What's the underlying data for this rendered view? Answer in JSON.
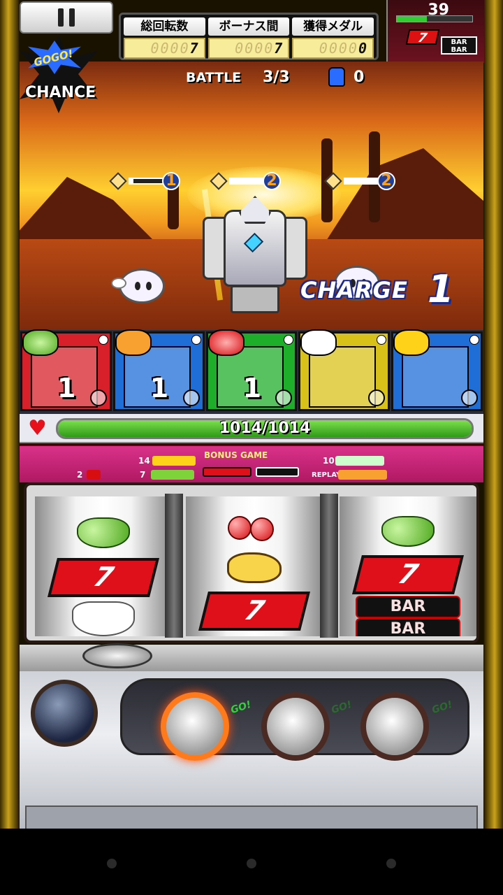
{
  "hud": {
    "counters": [
      {
        "label": "総回転数",
        "dim_digits": "0000",
        "value": "7"
      },
      {
        "label": "ボーナス間",
        "dim_digits": "0000",
        "value": "7"
      },
      {
        "label": "獲得メダル",
        "dim_digits": "0000",
        "value": "0"
      }
    ],
    "credit": "39",
    "credit_bar_level": 0.4,
    "credit_seven": "7",
    "credit_bar": "BAR BAR"
  },
  "badge": {
    "gogo": "GOGO!",
    "chance": "CHANCE"
  },
  "battle": {
    "label": "BATTLE",
    "round": "3/3",
    "bag_count": "0",
    "enemy_turns": [
      "1",
      "2",
      "2"
    ],
    "enemy_hp_levels": [
      0.1,
      1.0,
      1.0
    ],
    "charge_label": "CHARGE",
    "charge_value": "1"
  },
  "cards": [
    {
      "color": "#d8202a",
      "emblem": "grapes-icon",
      "count": "1"
    },
    {
      "color": "#1f6ed8",
      "emblem": "rhino-icon",
      "count": "1"
    },
    {
      "color": "#1fae2a",
      "emblem": "cherry-icon",
      "count": "1"
    },
    {
      "color": "#d8c21a",
      "emblem": "clown-icon",
      "count": ""
    },
    {
      "color": "#1f6ed8",
      "emblem": "bell-icon",
      "count": ""
    }
  ],
  "hp": {
    "text": "1014/1014",
    "level": 1.0
  },
  "paytable": {
    "title": "BONUS GAME",
    "n14": "14",
    "n10": "10",
    "n2": "2",
    "n7": "7",
    "replay": "REPLAY"
  },
  "reels": {
    "left": [
      "grape",
      "seven",
      "clown"
    ],
    "center": [
      "cherry",
      "rhino",
      "seven"
    ],
    "right": [
      "grape",
      "seven",
      "bar"
    ]
  },
  "symbols": {
    "seven": "7",
    "bar": "BAR"
  },
  "controls": {
    "go": "GO!"
  }
}
